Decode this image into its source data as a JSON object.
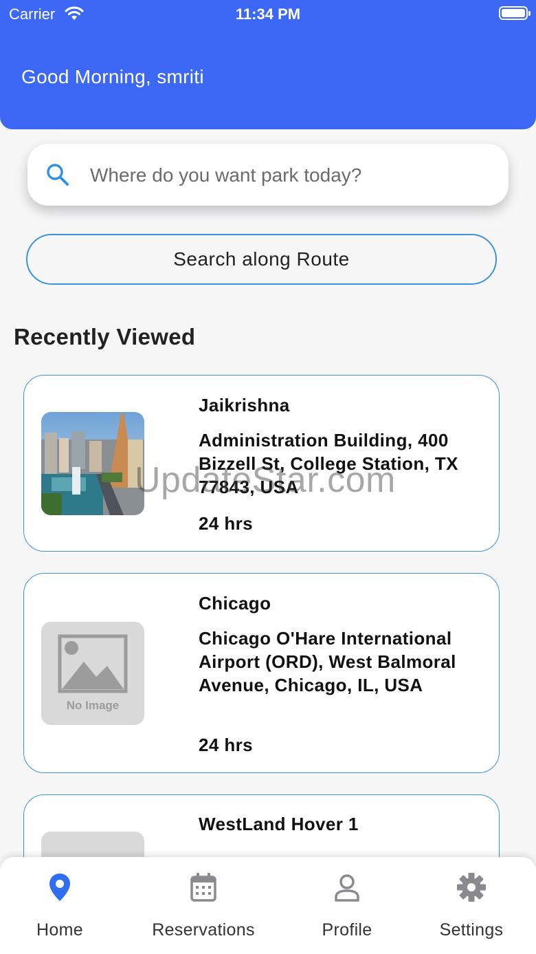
{
  "status_bar": {
    "carrier": "Carrier",
    "time": "11:34 PM"
  },
  "header": {
    "greeting": "Good Morning, smriti"
  },
  "search": {
    "placeholder": "Where do you want park today?"
  },
  "route_button": {
    "label": "Search along Route"
  },
  "recently_viewed": {
    "title": "Recently Viewed",
    "items": [
      {
        "name": "Jaikrishna",
        "address": "Administration Building, 400 Bizzell St, College Station, TX 77843, USA",
        "hours": "24 hrs",
        "image": "city-photo"
      },
      {
        "name": "Chicago",
        "address": "Chicago O'Hare International Airport (ORD), West Balmoral Avenue, Chicago, IL, USA",
        "hours": "24 hrs",
        "image": "no-image",
        "no_image_label": "No Image"
      },
      {
        "name": "WestLand Hover 1",
        "address": "",
        "hours": "",
        "image": "no-image"
      }
    ]
  },
  "watermark": "UpdateStar.com",
  "tabs": [
    {
      "label": "Home",
      "icon": "location-pin-icon",
      "active": true
    },
    {
      "label": "Reservations",
      "icon": "calendar-icon",
      "active": false
    },
    {
      "label": "Profile",
      "icon": "user-icon",
      "active": false
    },
    {
      "label": "Settings",
      "icon": "gear-icon",
      "active": false
    }
  ],
  "colors": {
    "header": "#3d67f5",
    "accent": "#3b93df",
    "active_tab": "#2f6ef2",
    "inactive_tab": "#8a8a8e"
  }
}
